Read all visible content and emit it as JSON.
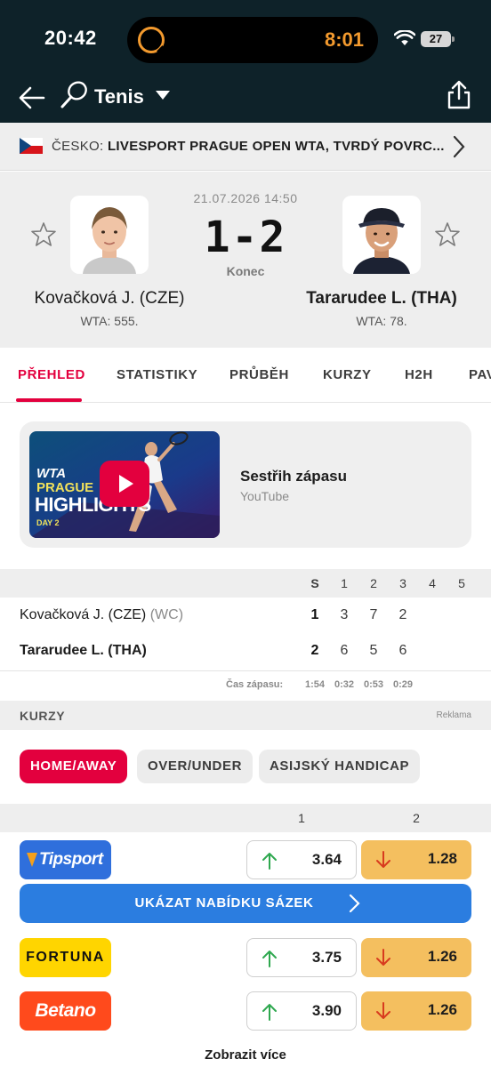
{
  "status_bar": {
    "time": "20:42",
    "timer": "8:01",
    "battery": "27"
  },
  "app_bar": {
    "sport": "Tenis"
  },
  "tournament": {
    "country": "ČESKO:",
    "name": "LIVESPORT PRAGUE OPEN WTA, TVRDÝ POVRC..."
  },
  "match": {
    "datetime": "21.07.2026 14:50",
    "score": "1-2",
    "status": "Konec",
    "home": {
      "name": "Kovačková J. (CZE)",
      "rank": "WTA: 555."
    },
    "away": {
      "name": "Tararudee L. (THA)",
      "rank": "WTA: 78."
    }
  },
  "tabs": [
    "PŘEHLED",
    "STATISTIKY",
    "PRŮBĚH",
    "KURZY",
    "H2H",
    "PAV"
  ],
  "highlight": {
    "title": "Sestřih zápasu",
    "source": "YouTube",
    "thumb": {
      "line1": "WTA",
      "line2": "PRAGUE",
      "line3": "HIGHLIGHTS",
      "line4": "DAY 2"
    }
  },
  "sets": {
    "columns": [
      "S",
      "1",
      "2",
      "3",
      "4",
      "5"
    ],
    "rows": [
      {
        "name": "Kovačková J. (CZE)",
        "tag": "(WC)",
        "total": "1",
        "scores": [
          "3",
          "7",
          "2"
        ]
      },
      {
        "name": "Tararudee L. (THA)",
        "tag": "",
        "total": "2",
        "scores": [
          "6",
          "5",
          "6"
        ]
      }
    ],
    "duration_label": "Čas zápasu:",
    "durations": [
      "1:54",
      "0:32",
      "0:53",
      "0:29"
    ]
  },
  "odds": {
    "title": "KURZY",
    "ad": "Reklama",
    "chips": [
      "HOME/AWAY",
      "OVER/UNDER",
      "ASIJSKÝ HANDICAP"
    ],
    "columns": [
      "1",
      "2"
    ],
    "offer_button": "UKÁZAT NABÍDKU SÁZEK",
    "bookmakers": [
      {
        "name": "Tipsport",
        "home": "3.64",
        "away": "1.28",
        "color": "#2f6fdc"
      },
      {
        "name": "FORTUNA",
        "home": "3.75",
        "away": "1.26",
        "color": "#ffd500"
      },
      {
        "name": "Betano",
        "home": "3.90",
        "away": "1.26",
        "color": "#ff4a1c"
      }
    ],
    "more": "Zobrazit více"
  },
  "colors": {
    "brand_red": "#e3003e",
    "dark_header": "#0e2229",
    "odds_down": "#f4bf5f",
    "odds_up_arrow": "#2fa84f",
    "offer_blue": "#2b7de0"
  }
}
